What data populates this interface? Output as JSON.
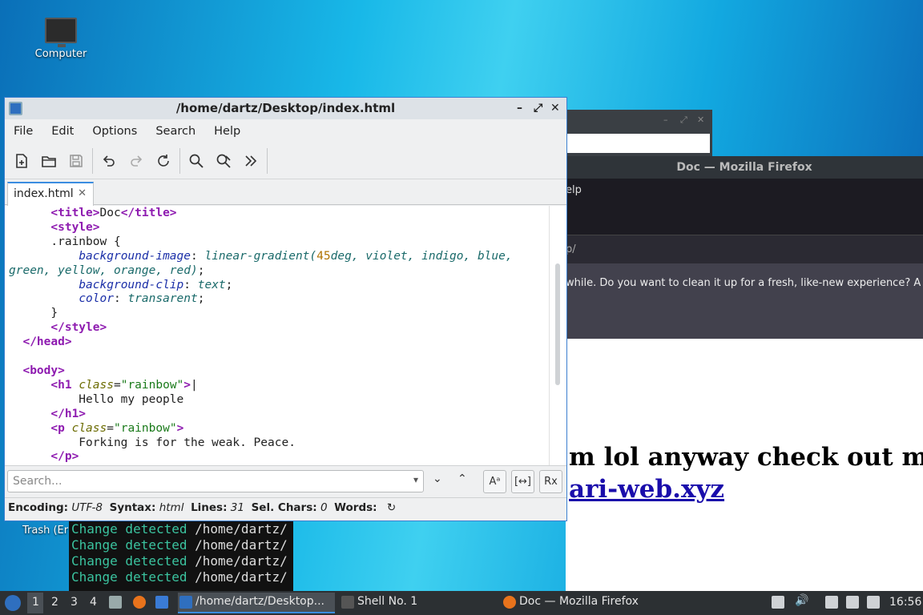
{
  "desktop": {
    "computer_label": "Computer",
    "trash_label": "Trash (Er"
  },
  "firefox": {
    "title": "Doc — Mozilla Firefox",
    "menu_fragment": "elp",
    "url_fragment": "p/",
    "notice": "while. Do you want to clean it up for a fresh, like-new experience? A",
    "h1_fragment": "m lol anyway check out m",
    "link_fragment": "ari-web.xyz"
  },
  "terminal": {
    "lines": [
      {
        "green": "Change detected",
        "white": " /home/dartz/"
      },
      {
        "green": "Change detected",
        "white": " /home/dartz/"
      },
      {
        "green": "Change detected",
        "white": " /home/dartz/"
      },
      {
        "green": "Change detected",
        "white": " /home/dartz/"
      }
    ]
  },
  "editor": {
    "title": "/home/dartz/Desktop/index.html",
    "window_controls": {
      "minimize": "–",
      "maximize": "⤢",
      "close": "✕"
    },
    "menu": {
      "file": "File",
      "edit": "Edit",
      "options": "Options",
      "search": "Search",
      "help": "Help"
    },
    "tab": {
      "label": "index.html",
      "close": "✕"
    },
    "search": {
      "placeholder": "Search...",
      "case_btn": "Aᵃ",
      "whole_btn": "[↔]",
      "regex_btn": "Rx"
    },
    "status": {
      "encoding_label": "Encoding:",
      "encoding": "UTF-8",
      "syntax_label": "Syntax:",
      "syntax": "html",
      "lines_label": "Lines:",
      "lines": "31",
      "sel_label": "Sel. Chars:",
      "sel": "0",
      "words_label": "Words:"
    }
  },
  "taskbar": {
    "workspaces": [
      "1",
      "2",
      "3",
      "4"
    ],
    "task1": "/home/dartz/Desktop...",
    "task2": "Shell No. 1",
    "task3": "Doc — Mozilla Firefox",
    "clock": "16:56"
  },
  "colors": {
    "accent": "#3b8de0",
    "tag": "#8e1bb0",
    "terminal_green": "#3bc4a0",
    "link": "#1a0dab"
  }
}
